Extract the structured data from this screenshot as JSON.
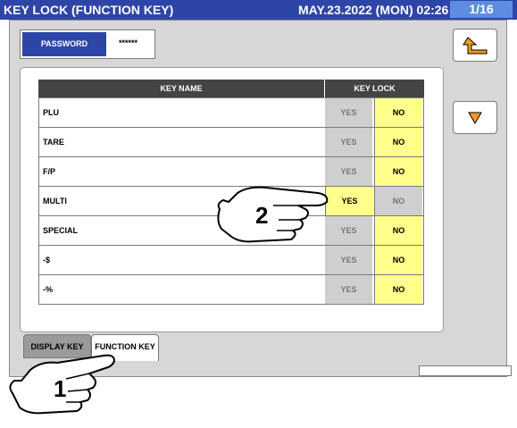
{
  "header": {
    "title": "KEY LOCK (FUNCTION KEY)",
    "datetime": "MAY.23.2022 (MON) 02:26",
    "page": "1/16"
  },
  "password": {
    "label": "PASSWORD",
    "value": "******"
  },
  "table": {
    "col_key_name": "KEY NAME",
    "col_key_lock": "KEY LOCK",
    "yes_label": "YES",
    "no_label": "NO",
    "rows": [
      {
        "name": "PLU",
        "lock": "NO"
      },
      {
        "name": "TARE",
        "lock": "NO"
      },
      {
        "name": "F/P",
        "lock": "NO"
      },
      {
        "name": "MULTI",
        "lock": "YES"
      },
      {
        "name": "SPECIAL",
        "lock": "NO"
      },
      {
        "name": "-$",
        "lock": "NO"
      },
      {
        "name": "-%",
        "lock": "NO"
      }
    ]
  },
  "tabs": [
    {
      "label": "DISPLAY KEY",
      "active": false
    },
    {
      "label": "FUNCTION KEY",
      "active": true
    }
  ],
  "buttons": {
    "back": "back-arrow-icon",
    "scroll_down": "down-triangle-icon"
  },
  "colors": {
    "title_bar": "#2e45a8",
    "selected": "#ffff8c",
    "unselected": "#cfcfcf",
    "page_indicator": "#5c8de0"
  },
  "callouts": [
    {
      "number": "1"
    },
    {
      "number": "2"
    }
  ]
}
